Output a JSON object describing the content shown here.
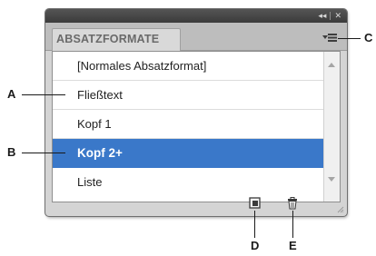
{
  "panel": {
    "title_controls": {
      "collapse_glyph": "◂◂",
      "close_glyph": "✕"
    },
    "tab_label": "ABSATZFORMATE",
    "menu_icon": "panel-menu-icon",
    "styles": [
      {
        "label": "[Normales Absatzformat]",
        "selected": false
      },
      {
        "label": "Fließtext",
        "selected": false
      },
      {
        "label": "Kopf 1",
        "selected": false
      },
      {
        "label": "Kopf 2+",
        "selected": true
      },
      {
        "label": "Liste",
        "selected": false
      }
    ],
    "footer_icons": [
      "new-style-icon",
      "trash-icon"
    ],
    "colors": {
      "selection": "#3a78c9",
      "titlebar": "#3b3b3b",
      "panel_bg": "#d4d4d4"
    }
  },
  "callouts": {
    "a": "A",
    "b": "B",
    "c": "C",
    "d": "D",
    "e": "E"
  }
}
